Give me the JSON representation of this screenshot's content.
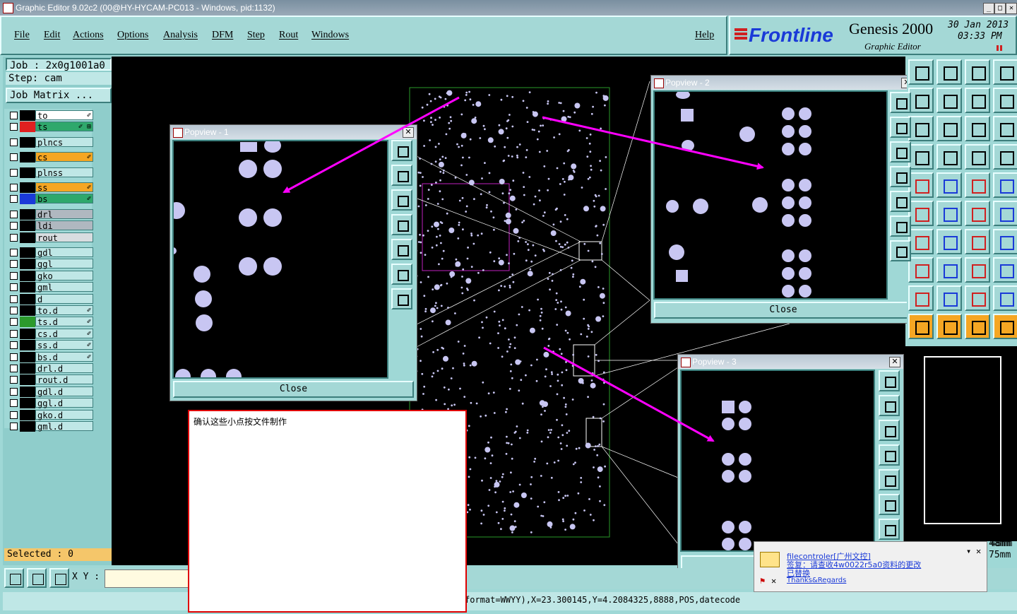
{
  "window": {
    "title": "Graphic Editor 9.02c2 (00@HY-HYCAM-PC013 - Windows, pid:1132)"
  },
  "menu": {
    "file": "File",
    "edit": "Edit",
    "actions": "Actions",
    "options": "Options",
    "analysis": "Analysis",
    "dfm": "DFM",
    "step": "Step",
    "rout": "Rout",
    "windows": "Windows",
    "help": "Help"
  },
  "brand": {
    "logo": "Frontline",
    "product": "Genesis 2000",
    "subtitle": "Graphic Editor",
    "date": "30 Jan 2013",
    "time": "03:33 PM"
  },
  "job": {
    "job_label": "Job : 2x0g1001a0",
    "step_label": "Step: cam",
    "matrix_button": "Job Matrix ..."
  },
  "layers": [
    {
      "name": "to",
      "color": "#000000",
      "bg": "#ffffff",
      "flag": "✐"
    },
    {
      "name": "ts",
      "color": "#e02020",
      "bg": "#2fa86c",
      "flag": "✐ ⊞"
    },
    {
      "name": "plncs",
      "color": "#000000",
      "bg": "#bfe7e6",
      "flag": ""
    },
    {
      "name": "cs",
      "color": "#000000",
      "bg": "#f5a623",
      "flag": "✐"
    },
    {
      "name": "plnss",
      "color": "#000000",
      "bg": "#bfe7e6",
      "flag": ""
    },
    {
      "name": "ss",
      "color": "#000000",
      "bg": "#f5a623",
      "flag": "✐"
    },
    {
      "name": "bs",
      "color": "#1a3ad8",
      "bg": "#2fa86c",
      "flag": "✐"
    },
    {
      "name": "drl",
      "color": "#000000",
      "bg": "#b0b8c0",
      "flag": ""
    },
    {
      "name": "ldi",
      "color": "#000000",
      "bg": "#b0b8c0",
      "flag": ""
    },
    {
      "name": "rout",
      "color": "#000000",
      "bg": "#d8dde0",
      "flag": ""
    },
    {
      "name": "gdl",
      "color": "#000000",
      "bg": "#bfe7e6",
      "flag": ""
    },
    {
      "name": "ggl",
      "color": "#000000",
      "bg": "#bfe7e6",
      "flag": ""
    },
    {
      "name": "gko",
      "color": "#000000",
      "bg": "#bfe7e6",
      "flag": ""
    },
    {
      "name": "gml",
      "color": "#000000",
      "bg": "#bfe7e6",
      "flag": ""
    },
    {
      "name": "d",
      "color": "#000000",
      "bg": "#bfe7e6",
      "flag": ""
    },
    {
      "name": "to.d",
      "color": "#000000",
      "bg": "#bfe7e6",
      "flag": "✐"
    },
    {
      "name": "ts.d",
      "color": "#2c9a2c",
      "bg": "#bfe7e6",
      "flag": "✐"
    },
    {
      "name": "cs.d",
      "color": "#000000",
      "bg": "#bfe7e6",
      "flag": "✐"
    },
    {
      "name": "ss.d",
      "color": "#000000",
      "bg": "#bfe7e6",
      "flag": "✐"
    },
    {
      "name": "bs.d",
      "color": "#000000",
      "bg": "#bfe7e6",
      "flag": "✐"
    },
    {
      "name": "drl.d",
      "color": "#000000",
      "bg": "#bfe7e6",
      "flag": ""
    },
    {
      "name": "rout.d",
      "color": "#000000",
      "bg": "#bfe7e6",
      "flag": ""
    },
    {
      "name": "gdl.d",
      "color": "#000000",
      "bg": "#bfe7e6",
      "flag": ""
    },
    {
      "name": "ggl.d",
      "color": "#000000",
      "bg": "#bfe7e6",
      "flag": ""
    },
    {
      "name": "gko.d",
      "color": "#000000",
      "bg": "#bfe7e6",
      "flag": ""
    },
    {
      "name": "gml.d",
      "color": "#000000",
      "bg": "#bfe7e6",
      "flag": ""
    }
  ],
  "selected": "Selected : 0",
  "popups": {
    "p1": "Popview - 1",
    "p2": "Popview - 2",
    "p3": "Popview - 3",
    "close": "Close"
  },
  "note": {
    "text": "确认这些小点按文件制作"
  },
  "coords": {
    "xy_label": "X Y :",
    "readout1": "48mm",
    "readout2": "75mm"
  },
  "command_line": "format=WWYY),X=23.300145,Y=4.2084325,8888,POS,datecode",
  "notification": {
    "line1": "filecontroler[广州文控]",
    "line2": "签复：请查收4w0022r5a0资料的更改",
    "line3": "已替换",
    "line4": "Thanks&Regards"
  },
  "colors": {
    "accent": "#a4d8d6",
    "pad": "#c8c6f2",
    "arrow": "#ff00ff"
  }
}
